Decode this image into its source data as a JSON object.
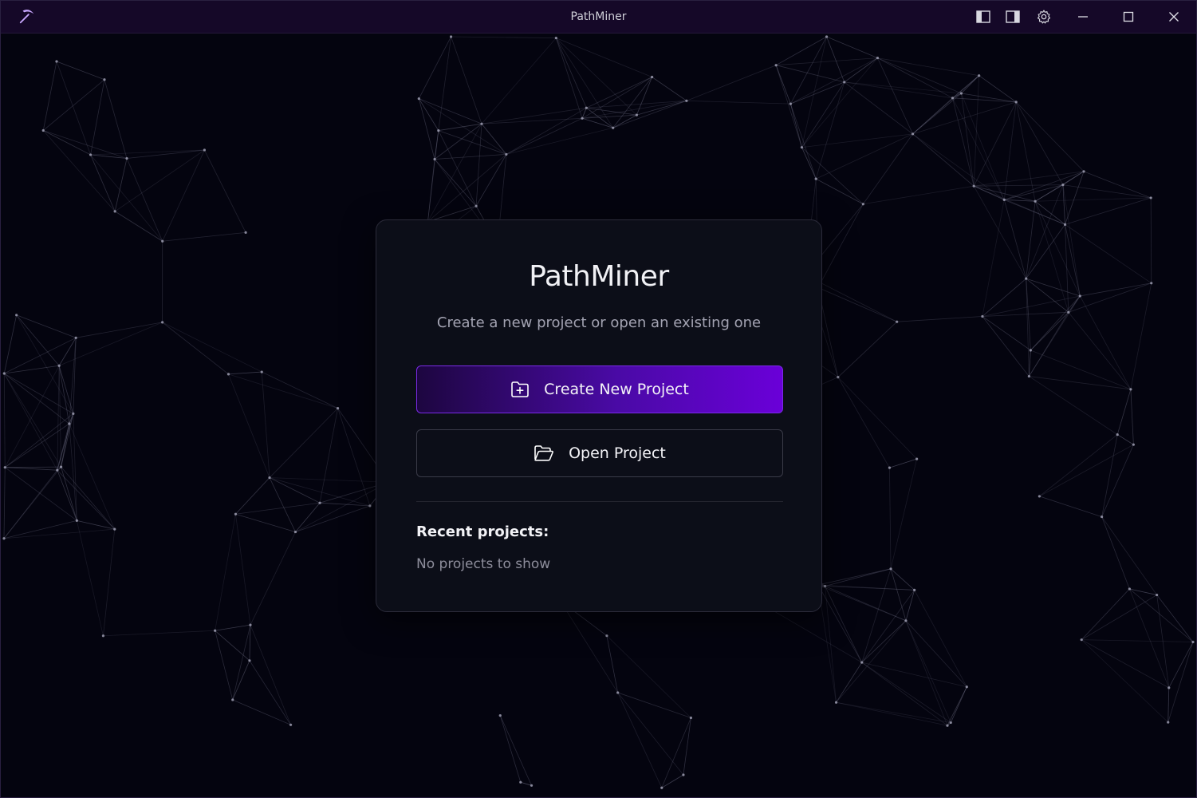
{
  "window": {
    "title": "PathMiner"
  },
  "titlebar": {
    "icons": [
      "pickaxe-icon",
      "toggle-left-panel-icon",
      "toggle-right-panel-icon",
      "gear-icon",
      "minimize-icon",
      "maximize-icon",
      "close-icon"
    ]
  },
  "welcome": {
    "title": "PathMiner",
    "subtitle": "Create a new project or open an existing one",
    "create_label": "Create New Project",
    "open_label": "Open Project",
    "recent_heading": "Recent projects:",
    "recent_empty": "No projects to show"
  },
  "colors": {
    "background": "#04040f",
    "titlebar": "#150828",
    "accent": "#6a00d8",
    "network_lines": "#6a6a80"
  }
}
